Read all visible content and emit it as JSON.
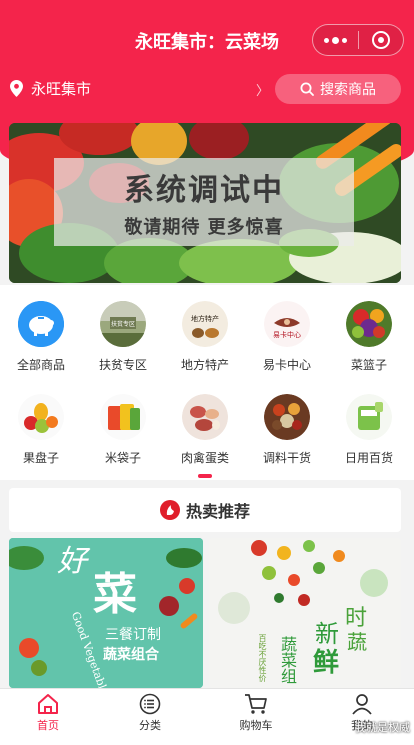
{
  "header": {
    "title": "永旺集市：云菜场",
    "location": "永旺集市",
    "chevron": "〉",
    "search_label": "搜索商品"
  },
  "banner": {
    "title": "系统调试中",
    "subtitle": "敬请期待 更多惊喜"
  },
  "categories": [
    {
      "label": "全部商品",
      "icon": "piggy-bank-icon"
    },
    {
      "label": "扶贫专区",
      "icon": "poverty-relief-icon"
    },
    {
      "label": "地方特产",
      "icon": "local-specialty-icon"
    },
    {
      "label": "易卡中心",
      "icon": "card-center-icon"
    },
    {
      "label": "菜篮子",
      "icon": "vegetable-basket-icon"
    },
    {
      "label": "果盘子",
      "icon": "fruit-plate-icon"
    },
    {
      "label": "米袋子",
      "icon": "rice-bag-icon"
    },
    {
      "label": "肉禽蛋类",
      "icon": "meat-eggs-icon"
    },
    {
      "label": "调料干货",
      "icon": "seasoning-icon"
    },
    {
      "label": "日用百货",
      "icon": "daily-goods-icon"
    }
  ],
  "category_icon_texts": {
    "poverty_relief": "扶贫专区",
    "local_specialty": "地方特产",
    "card_center": "易卡中心"
  },
  "hot": {
    "title": "热卖推荐"
  },
  "products": [
    {
      "line1": "好",
      "line2": "菜",
      "line3": "Good Vegetables",
      "line4": "三餐订制",
      "line5": "蔬菜组合"
    },
    {
      "line1": "新",
      "line2": "鲜",
      "line3": "时",
      "line4": "蔬",
      "line5": "蔬菜组",
      "line6": "百吃不厌性价"
    }
  ],
  "tabbar": [
    {
      "label": "首页",
      "icon": "home-icon",
      "active": true
    },
    {
      "label": "分类",
      "icon": "category-icon",
      "active": false
    },
    {
      "label": "购物车",
      "icon": "cart-icon",
      "active": false
    },
    {
      "label": "我的",
      "icon": "user-icon",
      "active": false
    }
  ],
  "watermark": "我就是权威",
  "colors": {
    "primary": "#f4244b",
    "tab_active": "#f4244b"
  }
}
